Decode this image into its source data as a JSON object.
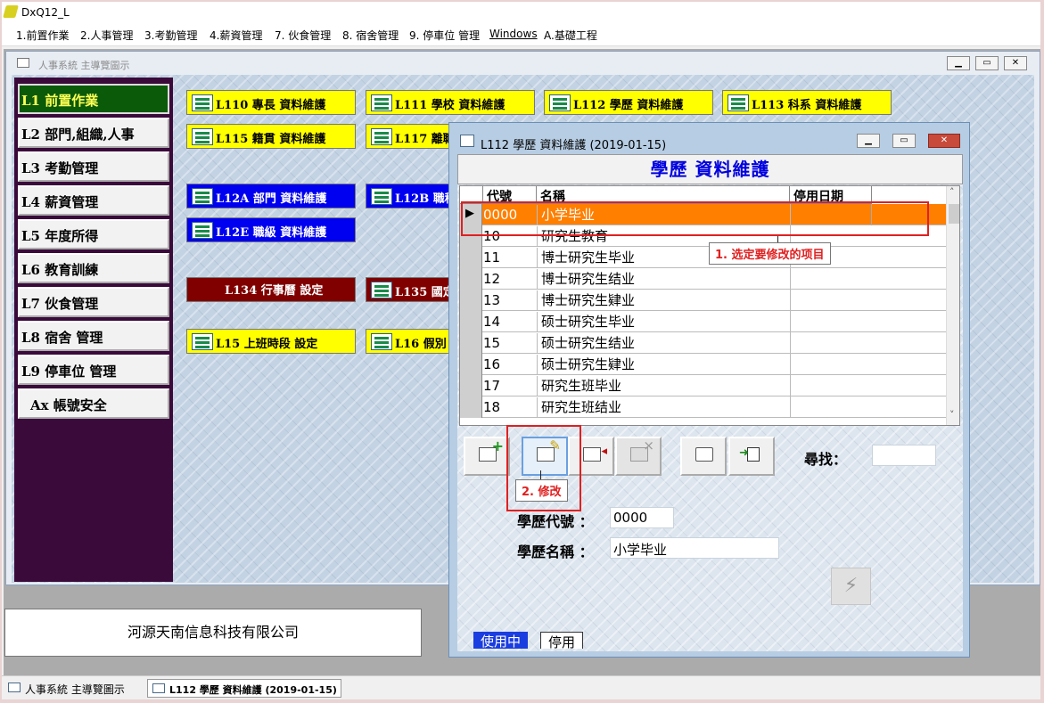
{
  "app": {
    "title": "DxQ12_L"
  },
  "menu": [
    "1.前置作業",
    "2.人事管理",
    "3.考勤管理",
    "4.薪資管理",
    "7. 伙食管理",
    "8. 宿舍管理",
    "9. 停車位 管理",
    "Windows",
    "A.基礎工程"
  ],
  "main_window": {
    "title": "人事系統  主導覽圖示"
  },
  "sidebar": {
    "items": [
      "L1 前置作業",
      "L2 部門,組織,人事",
      "L3 考勤管理",
      "L4 薪資管理",
      "L5 年度所得",
      "L6 教育訓練",
      "L7 伙食管理",
      "L8 宿舍 管理",
      "L9 停車位 管理",
      "Ax 帳號安全"
    ],
    "active_index": 0
  },
  "tiles": {
    "l110": "L110 專長 資料維護",
    "l111": "L111 學校 資料維護",
    "l112": "L112 學歷 資料維護",
    "l113": "L113 科系 資料維護",
    "l115": "L115 籍貫 資料維護",
    "l117": "L117 離職",
    "l12a": "L12A 部門 資料維護",
    "l12b": "L12B 職稱",
    "l12e": "L12E 職級 資料維護",
    "l134": "L134 行事曆 設定",
    "l135": "L135 國定",
    "l15": "L15 上班時段 設定",
    "l16": "L16 假別"
  },
  "company": "河源天南信息科技有限公司",
  "taskbar": {
    "items": [
      "人事系統 主導覽圖示",
      "L112 學歷 資料維護 (2019-01-15)"
    ]
  },
  "dialog": {
    "title": "L112 學歷 資料維護 (2019-01-15)",
    "header": "學歷 資料維護",
    "grid": {
      "columns": [
        "代號",
        "名稱",
        "停用日期"
      ],
      "rows": [
        {
          "code": "0000",
          "name": "小学毕业",
          "disabled_date": ""
        },
        {
          "code": "10",
          "name": "研究生教育",
          "disabled_date": ""
        },
        {
          "code": "11",
          "name": "博士研究生毕业",
          "disabled_date": ""
        },
        {
          "code": "12",
          "name": "博士研究生结业",
          "disabled_date": ""
        },
        {
          "code": "13",
          "name": "博士研究生肄业",
          "disabled_date": ""
        },
        {
          "code": "14",
          "name": "硕士研究生毕业",
          "disabled_date": ""
        },
        {
          "code": "15",
          "name": "硕士研究生结业",
          "disabled_date": ""
        },
        {
          "code": "16",
          "name": "硕士研究生肄业",
          "disabled_date": ""
        },
        {
          "code": "17",
          "name": "研究生班毕业",
          "disabled_date": ""
        },
        {
          "code": "18",
          "name": "研究生班结业",
          "disabled_date": ""
        }
      ],
      "selected_index": 0,
      "row_pointer": "▶"
    },
    "toolbar": [
      "add-icon",
      "edit-icon",
      "delete-icon",
      "delete-disabled-icon",
      "print-icon",
      "exit-icon"
    ],
    "search_label": "尋找：",
    "search_value": "",
    "code_label": "學歷代號 ：",
    "code_value": "0000",
    "name_label": "學歷名稱 ：",
    "name_value": "小学毕业",
    "tabs": [
      "使用中",
      "停用"
    ]
  },
  "annotations": {
    "step1": "1. 选定要修改的项目",
    "step2": "2. 修改"
  },
  "colors": {
    "selected_row": "#ff7f00",
    "dialog_header_text": "#0000e0",
    "annotation_red": "#e02020",
    "sidebar_bg": "#3a0a3a",
    "active_sidebar_bg": "#0a5a0a"
  }
}
